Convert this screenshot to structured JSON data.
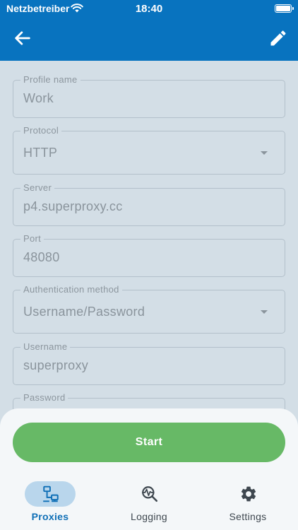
{
  "status_bar": {
    "carrier": "Netzbetreiber",
    "time": "18:40"
  },
  "app_bar": {
    "back_icon": "arrow-back-icon",
    "edit_icon": "pencil-icon"
  },
  "form": {
    "profile_name": {
      "label": "Profile name",
      "value": "Work"
    },
    "protocol": {
      "label": "Protocol",
      "value": "HTTP"
    },
    "server": {
      "label": "Server",
      "value": "p4.superproxy.cc"
    },
    "port": {
      "label": "Port",
      "value": "48080"
    },
    "auth_method": {
      "label": "Authentication method",
      "value": "Username/Password"
    },
    "username": {
      "label": "Username",
      "value": "superproxy"
    },
    "password": {
      "label": "Password"
    }
  },
  "actions": {
    "start_label": "Start"
  },
  "bottom_nav": {
    "items": [
      {
        "label": "Proxies",
        "icon": "network-icon",
        "active": true
      },
      {
        "label": "Logging",
        "icon": "activity-search-icon",
        "active": false
      },
      {
        "label": "Settings",
        "icon": "gear-icon",
        "active": false
      }
    ]
  },
  "colors": {
    "app_bar": "#0873bf",
    "background": "#d3dee6",
    "start_button": "#67b966",
    "active_nav": "#0f6fb6",
    "active_pill": "#b9d6ec"
  }
}
